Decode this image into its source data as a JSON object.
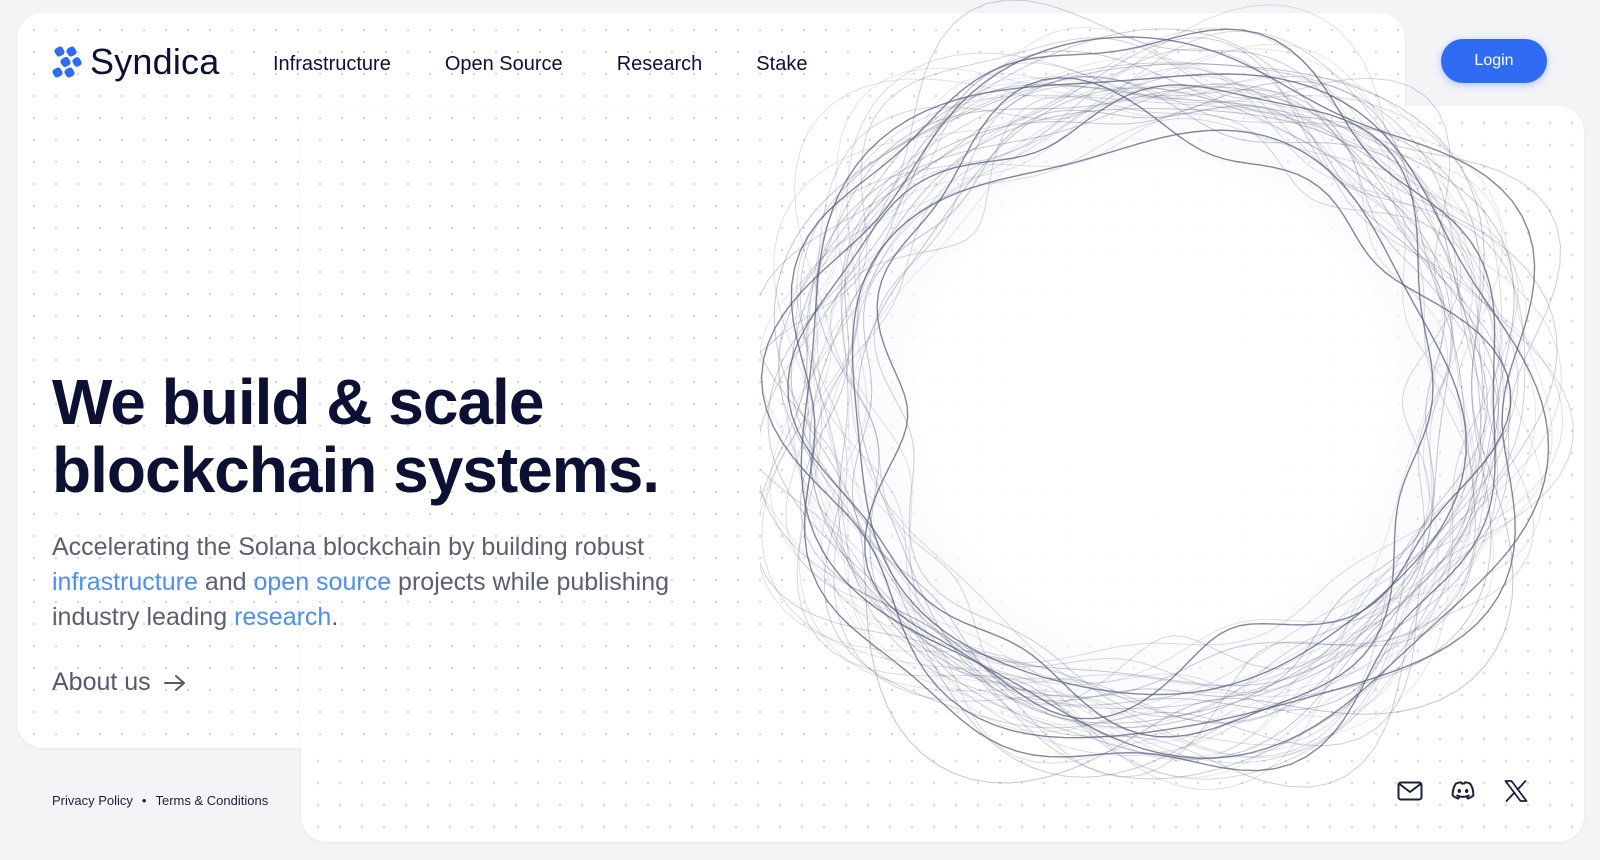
{
  "brand": {
    "name": "Syndica",
    "accent_color": "#2f6cf3",
    "logo_icon": "syndica-logo-icon"
  },
  "nav": {
    "items": [
      {
        "label": "Infrastructure"
      },
      {
        "label": "Open Source"
      },
      {
        "label": "Research"
      },
      {
        "label": "Stake"
      }
    ],
    "login_label": "Login"
  },
  "hero": {
    "title_line1": "We build & scale",
    "title_line2": "blockchain systems.",
    "subtitle": {
      "part1": "Accelerating the Solana blockchain by building robust ",
      "link1": "infrastructure",
      "part2": " and ",
      "link2": "open source",
      "part3": " projects while publishing industry leading ",
      "link3": "research",
      "part4": "."
    },
    "link_color": "#4d8ef0",
    "cta_label": "About us",
    "cta_icon": "arrow-right-icon"
  },
  "footer": {
    "privacy_label": "Privacy Policy",
    "separator": "•",
    "terms_label": "Terms & Conditions",
    "social_icons": [
      "mail-icon",
      "discord-icon",
      "x-icon"
    ]
  },
  "art": {
    "icon": "wave-rings-graphic",
    "stroke_color": "#5a5e7e"
  }
}
